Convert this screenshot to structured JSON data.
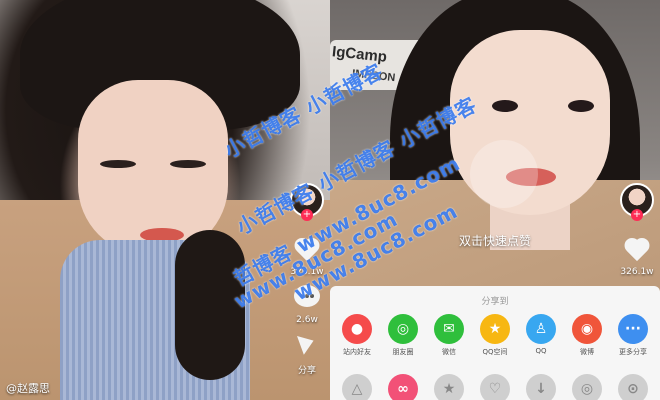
{
  "left": {
    "username": "@赵露思",
    "likes": "326.1w",
    "comments": "2.6w",
    "share_label": "分享"
  },
  "right": {
    "sign_line1": "IgCamp",
    "sign_line2": "IMPSON",
    "tap_hint": "双击快速点赞",
    "likes": "326.1w",
    "sheet": {
      "title": "分享到",
      "items": [
        {
          "label": "站内好友",
          "icon": "chat-icon",
          "color": "#f54b4b",
          "glyph": "●"
        },
        {
          "label": "朋友圈",
          "icon": "moments-icon",
          "color": "#2fbf3c",
          "glyph": "◎"
        },
        {
          "label": "微信",
          "icon": "wechat-icon",
          "color": "#2fbf3c",
          "glyph": "✉"
        },
        {
          "label": "QQ空间",
          "icon": "qzone-icon",
          "color": "#f7b712",
          "glyph": "★"
        },
        {
          "label": "QQ",
          "icon": "qq-icon",
          "color": "#38a7f0",
          "glyph": "♙"
        },
        {
          "label": "微博",
          "icon": "weibo-icon",
          "color": "#f0553a",
          "glyph": "◉"
        },
        {
          "label": "更多分享",
          "icon": "more-icon",
          "color": "#3e8ff0",
          "glyph": "···"
        }
      ]
    }
  },
  "watermark": {
    "line1": "小哲博客 小哲博客",
    "line2": "小哲博客 小哲博客 小哲博客",
    "line3": "哲博客 www.8uc8.com",
    "line4": "www.8uc8.com",
    "line5": "www.8uc8.com"
  }
}
